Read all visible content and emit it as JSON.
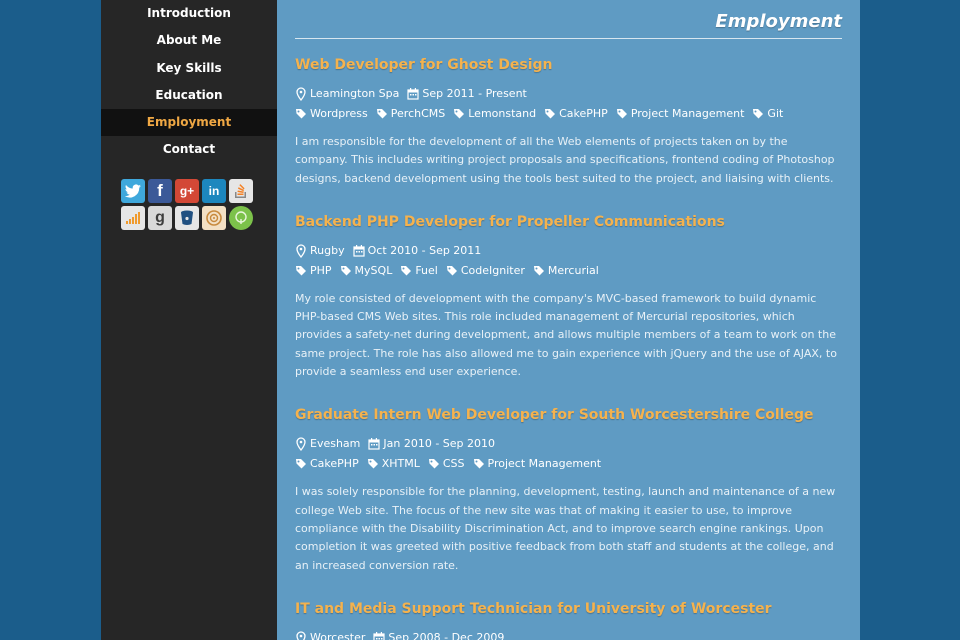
{
  "nav": {
    "items": [
      "Introduction",
      "About Me",
      "Key Skills",
      "Education",
      "Employment",
      "Contact"
    ],
    "active": "Employment"
  },
  "social": {
    "row1": [
      "twitter-icon",
      "facebook-icon",
      "google-plus-icon",
      "linkedin-icon",
      "stackoverflow-icon"
    ],
    "row2": [
      "rss-icon",
      "goodreads-icon",
      "bitbucket-icon",
      "target-icon",
      "tree-icon"
    ]
  },
  "page": {
    "title": "Employment"
  },
  "jobs": [
    {
      "title": "Web Developer for Ghost Design",
      "location": "Leamington Spa",
      "dates": "Sep 2011 - Present",
      "tags": [
        "Wordpress",
        "PerchCMS",
        "Lemonstand",
        "CakePHP",
        "Project Management",
        "Git"
      ],
      "description": "I am responsible for the development of all the Web elements of projects taken on by the company. This includes writing project proposals and specifications, frontend coding of Photoshop designs, backend development using the tools best suited to the project, and liaising with clients."
    },
    {
      "title": "Backend PHP Developer for Propeller Communications",
      "location": "Rugby",
      "dates": "Oct 2010 - Sep 2011",
      "tags": [
        "PHP",
        "MySQL",
        "Fuel",
        "CodeIgniter",
        "Mercurial"
      ],
      "description": "My role consisted of development with the company's MVC-based framework to build dynamic PHP-based CMS Web sites. This role included management of Mercurial repositories, which provides a safety-net during development, and allows multiple members of a team to work on the same project. The role has also allowed me to gain experience with jQuery and the use of AJAX, to provide a seamless end user experience."
    },
    {
      "title": "Graduate Intern Web Developer for South Worcestershire College",
      "location": "Evesham",
      "dates": "Jan 2010 - Sep 2010",
      "tags": [
        "CakePHP",
        "XHTML",
        "CSS",
        "Project Management"
      ],
      "description": "I was solely responsible for the planning, development, testing, launch and maintenance of a new college Web site. The focus of the new site was that of making it easier to use, to improve compliance with the Disability Discrimination Act, and to improve search engine rankings. Upon completion it was greeted with positive feedback from both staff and students at the college, and an increased conversion rate."
    },
    {
      "title": "IT and Media Support Technician for University of Worcester",
      "location": "Worcester",
      "dates": "Sep 2008 - Dec 2009",
      "tags": [],
      "description": ""
    }
  ]
}
